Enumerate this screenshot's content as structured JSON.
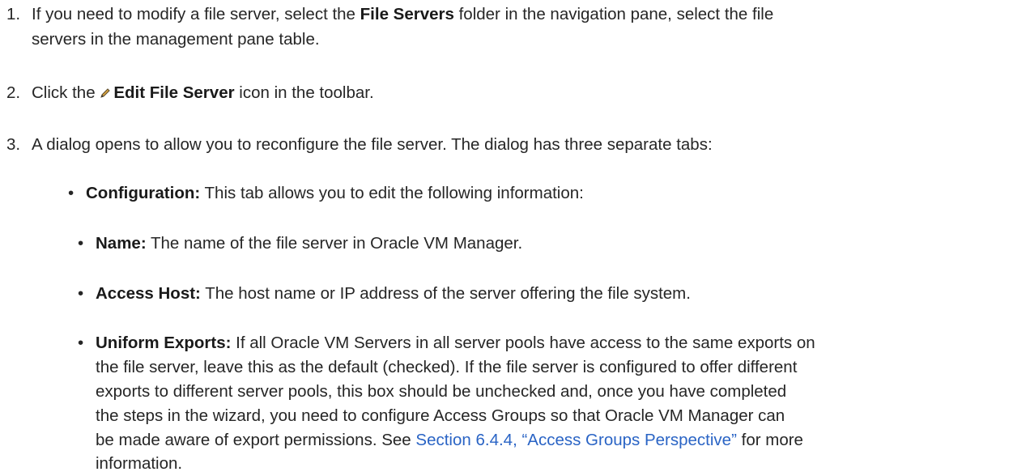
{
  "steps": [
    {
      "num": "1.",
      "line1_pre": "If you need to modify a file server, select the ",
      "line1_bold": "File Servers",
      "line1_post": " folder in the navigation pane, select the file",
      "line2": "servers in the management pane table."
    },
    {
      "num": "2.",
      "pre": "Click the ",
      "icon": "pencil-icon",
      "bold": "Edit File Server",
      "post": " icon in the toolbar."
    },
    {
      "num": "3.",
      "text": "A dialog opens to allow you to reconfigure the file server. The dialog has three separate tabs:"
    }
  ],
  "configuration": {
    "bullet": "•",
    "label": "Configuration:",
    "text": " This tab allows you to edit the following information:"
  },
  "fields": [
    {
      "bullet": "•",
      "label": "Name:",
      "text": " The name of the file server in Oracle VM Manager."
    },
    {
      "bullet": "•",
      "label": "Access Host:",
      "text": " The host name or IP address of the server offering the file system."
    },
    {
      "bullet": "•",
      "label": "Uniform Exports:",
      "line1": " If all Oracle VM Servers in all server pools have access to the same exports on",
      "line2": "the file server, leave this as the default (checked). If the file server is configured to offer different",
      "line3": "exports to different server pools, this box should be unchecked and, once you have completed",
      "line4": "the steps in the wizard, you need to configure Access Groups so that Oracle VM Manager can",
      "line5_pre": "be made aware of export permissions. See ",
      "line5_link": "Section 6.4.4, “Access Groups Perspective”",
      "line5_post": " for more",
      "line6": "information."
    }
  ],
  "colors": {
    "text": "#262626",
    "link": "#2a64c5"
  }
}
